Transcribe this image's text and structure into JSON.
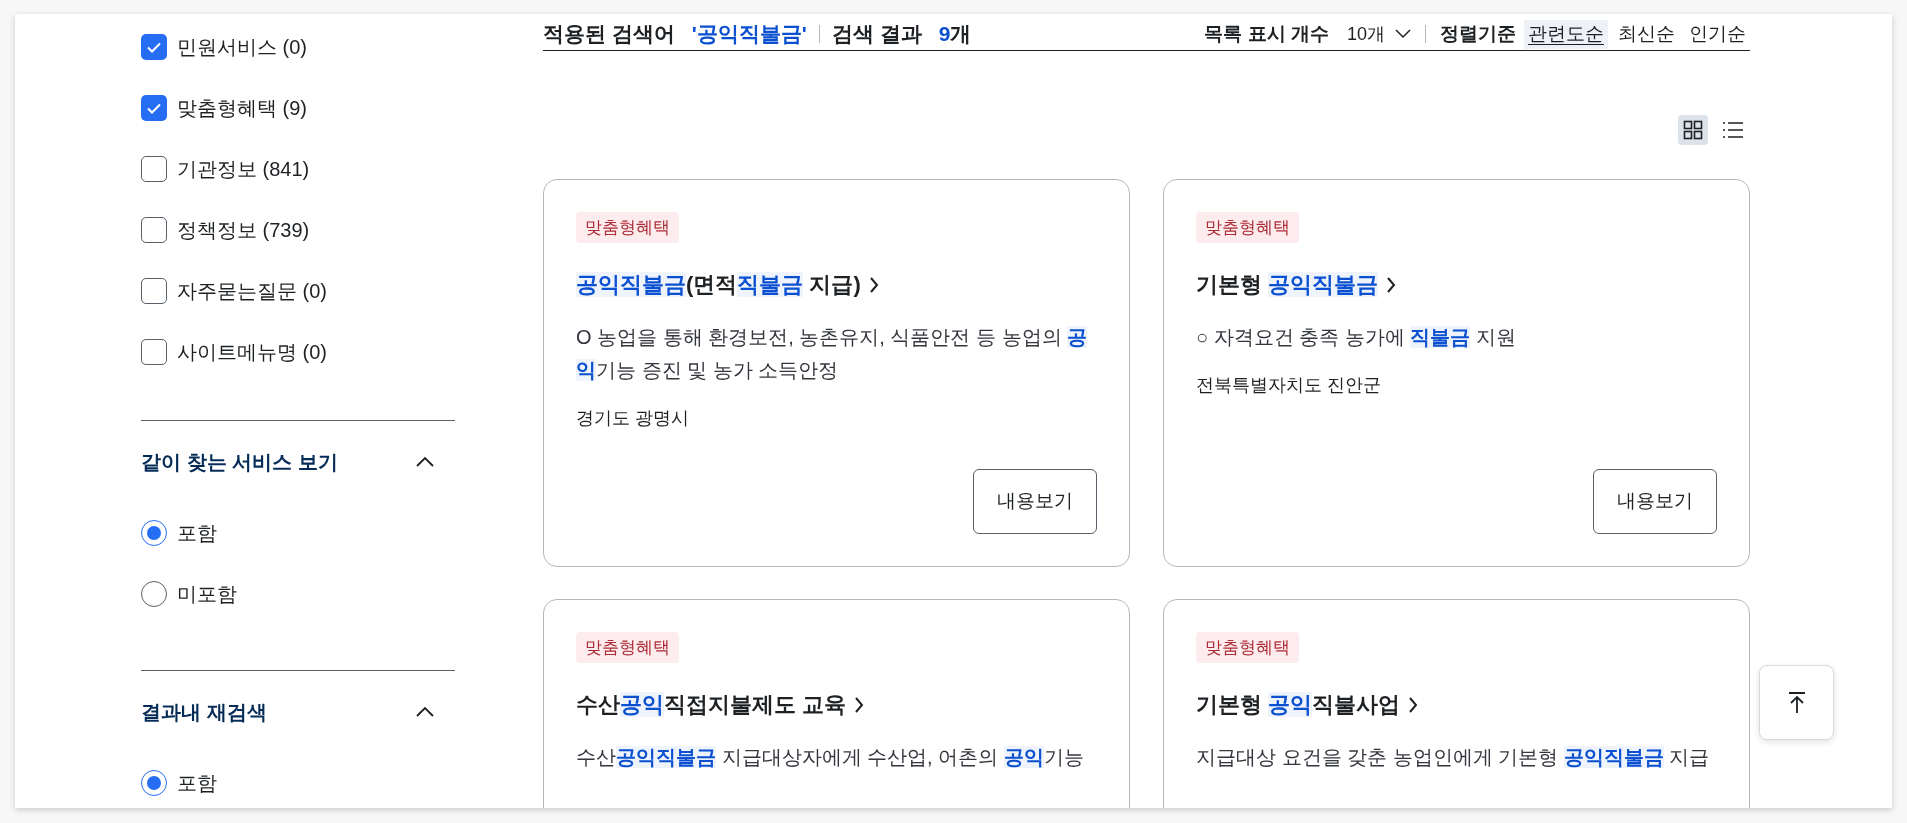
{
  "filters": {
    "categories": [
      {
        "label": "민원서비스 (0)",
        "checked": true
      },
      {
        "label": "맞춤형혜택 (9)",
        "checked": true
      },
      {
        "label": "기관정보 (841)",
        "checked": false
      },
      {
        "label": "정책정보 (739)",
        "checked": false
      },
      {
        "label": "자주묻는질문 (0)",
        "checked": false
      },
      {
        "label": "사이트메뉴명 (0)",
        "checked": false
      }
    ],
    "sections": [
      {
        "title": "같이 찾는 서비스 보기",
        "expanded": true,
        "options": [
          {
            "label": "포함",
            "selected": true
          },
          {
            "label": "미포함",
            "selected": false
          }
        ]
      },
      {
        "title": "결과내 재검색",
        "expanded": true,
        "options": [
          {
            "label": "포함",
            "selected": true
          }
        ]
      }
    ]
  },
  "results_header": {
    "applied_label": "적용된 검색어",
    "keyword": "'공익직불금'",
    "result_label": "검색 결과",
    "result_count": "9",
    "result_unit": "개",
    "page_size_label": "목록 표시 개수",
    "page_size": "10개",
    "sort_label": "정렬기준",
    "sort_options": [
      {
        "label": "관련도순",
        "selected": true
      },
      {
        "label": "최신순",
        "selected": false
      },
      {
        "label": "인기순",
        "selected": false
      }
    ]
  },
  "view_modes": [
    {
      "kind": "grid",
      "selected": true
    },
    {
      "kind": "list",
      "selected": false
    }
  ],
  "cards": [
    {
      "badge": "맞춤형혜택",
      "title": "**공익직불금**(면적**직불금** 지급)",
      "description": "O 농업을 통해 환경보전, 농촌유지, 식품안전 등 농업의 **공익**기능 증진 및 농가 소득안정",
      "region": "경기도 광명시",
      "button": "내용보기"
    },
    {
      "badge": "맞춤형혜택",
      "title": "기본형 **공익직불금**",
      "description": "○ 자격요건 충족 농가에 **직불금** 지원",
      "region": "전북특별자치도 진안군",
      "button": "내용보기"
    },
    {
      "badge": "맞춤형혜택",
      "title": "수산**공익**직접지불제도 교육",
      "description": "수산**공익직불금** 지급대상자에게 수산업, 어촌의 **공익**기능"
    },
    {
      "badge": "맞춤형혜택",
      "title": "기본형 **공익**직불사업",
      "description": "지급대상 요건을 갖춘 농업인에게 기본형 **공익직불금** 지급"
    }
  ]
}
